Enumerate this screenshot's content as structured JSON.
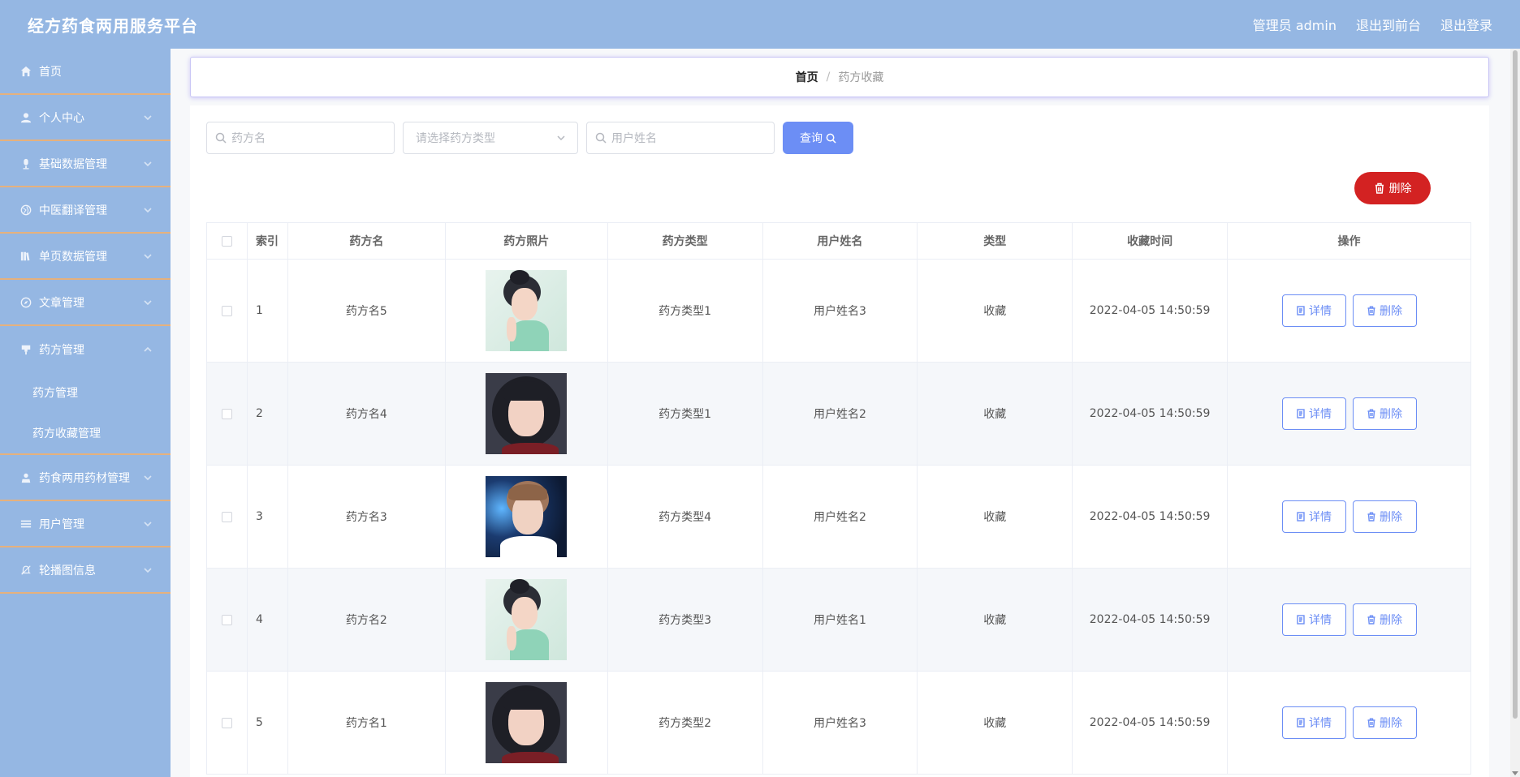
{
  "header": {
    "brand": "经方药食两用服务平台",
    "admin": "管理员 admin",
    "to_front": "退出到前台",
    "logout": "退出登录"
  },
  "sidebar": {
    "items": [
      {
        "label": "首页",
        "icon": "home-icon"
      },
      {
        "label": "个人中心",
        "icon": "user-icon"
      },
      {
        "label": "基础数据管理",
        "icon": "mic-icon"
      },
      {
        "label": "中医翻译管理",
        "icon": "globe-icon"
      },
      {
        "label": "单页数据管理",
        "icon": "books-icon"
      },
      {
        "label": "文章管理",
        "icon": "compass-icon"
      },
      {
        "label": "药方管理",
        "icon": "brush-icon"
      },
      {
        "label": "药食两用药材管理",
        "icon": "person-icon"
      },
      {
        "label": "用户管理",
        "icon": "menu-icon"
      },
      {
        "label": "轮播图信息",
        "icon": "bell-off-icon"
      }
    ],
    "submenu": [
      "药方管理",
      "药方收藏管理"
    ]
  },
  "breadcrumb": {
    "home": "首页",
    "sep": "/",
    "current": "药方收藏"
  },
  "search": {
    "name_placeholder": "药方名",
    "type_placeholder": "请选择药方类型",
    "user_placeholder": "用户姓名",
    "query_label": "查询"
  },
  "delete_label": "删除",
  "table": {
    "headers": [
      "索引",
      "药方名",
      "药方照片",
      "药方类型",
      "用户姓名",
      "类型",
      "收藏时间",
      "操作"
    ],
    "rows": [
      {
        "index": "1",
        "name": "药方名5",
        "photo": "woman-hairbun",
        "type": "药方类型1",
        "user": "用户姓名3",
        "kind": "收藏",
        "time": "2022-04-05 14:50:59"
      },
      {
        "index": "2",
        "name": "药方名4",
        "photo": "woman-bob",
        "type": "药方类型1",
        "user": "用户姓名2",
        "kind": "收藏",
        "time": "2022-04-05 14:50:59"
      },
      {
        "index": "3",
        "name": "药方名3",
        "photo": "man-portrait",
        "type": "药方类型4",
        "user": "用户姓名2",
        "kind": "收藏",
        "time": "2022-04-05 14:50:59"
      },
      {
        "index": "4",
        "name": "药方名2",
        "photo": "woman-hairbun",
        "type": "药方类型3",
        "user": "用户姓名1",
        "kind": "收藏",
        "time": "2022-04-05 14:50:59"
      },
      {
        "index": "5",
        "name": "药方名1",
        "photo": "woman-bob",
        "type": "药方类型2",
        "user": "用户姓名3",
        "kind": "收藏",
        "time": "2022-04-05 14:50:59"
      }
    ],
    "detail_label": "详情",
    "delete_label": "删除"
  },
  "colors": {
    "header_bg": "#95b7e3",
    "accent": "#6c8ef5",
    "danger": "#d32222",
    "divider": "#e5b17e"
  }
}
